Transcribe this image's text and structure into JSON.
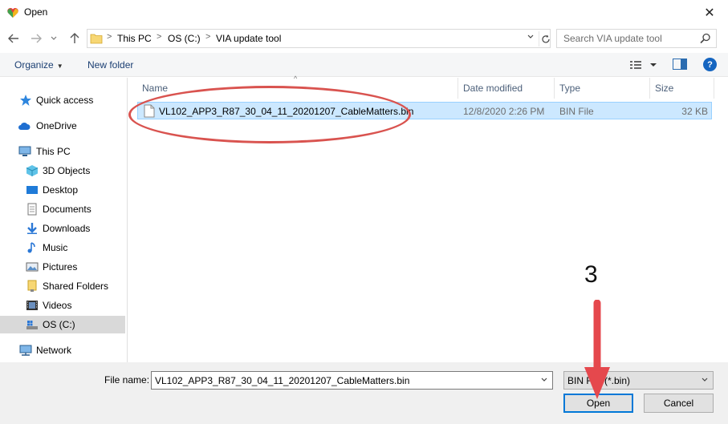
{
  "window": {
    "title": "Open",
    "close_glyph": "✕"
  },
  "address": {
    "crumbs": [
      "This PC",
      "OS (C:)",
      "VIA update tool"
    ],
    "separator": ">"
  },
  "search": {
    "placeholder": "Search VIA update tool"
  },
  "toolbar": {
    "organize": "Organize",
    "new_folder": "New folder",
    "help": "?"
  },
  "nav": {
    "items": [
      {
        "label": "Quick access",
        "icon": "star-icon"
      },
      {
        "label": "OneDrive",
        "icon": "cloud-icon"
      },
      {
        "label": "This PC",
        "icon": "computer-icon"
      },
      {
        "label": "3D Objects",
        "icon": "cube-icon"
      },
      {
        "label": "Desktop",
        "icon": "desktop-icon"
      },
      {
        "label": "Documents",
        "icon": "document-icon"
      },
      {
        "label": "Downloads",
        "icon": "download-icon"
      },
      {
        "label": "Music",
        "icon": "music-icon"
      },
      {
        "label": "Pictures",
        "icon": "pictures-icon"
      },
      {
        "label": "Shared Folders",
        "icon": "shared-folder-icon"
      },
      {
        "label": "Videos",
        "icon": "video-icon"
      },
      {
        "label": "OS (C:)",
        "icon": "drive-icon",
        "selected": true
      },
      {
        "label": "Network",
        "icon": "network-icon"
      }
    ]
  },
  "columns": {
    "name": "Name",
    "date": "Date modified",
    "type": "Type",
    "size": "Size"
  },
  "files": [
    {
      "name": "VL102_APP3_R87_30_04_11_20201207_CableMatters.bin",
      "date": "12/8/2020 2:26 PM",
      "type": "BIN File",
      "size": "32 KB"
    }
  ],
  "footer": {
    "file_name_label": "File name:",
    "file_name_value": "VL102_APP3_R87_30_04_11_20201207_CableMatters.bin",
    "file_type": "BIN File (*.bin)",
    "open": "Open",
    "cancel": "Cancel"
  },
  "annotation": {
    "step": "3",
    "color": "#e5484d"
  },
  "colors": {
    "selection": "#cce8ff",
    "accent": "#0078d7"
  }
}
